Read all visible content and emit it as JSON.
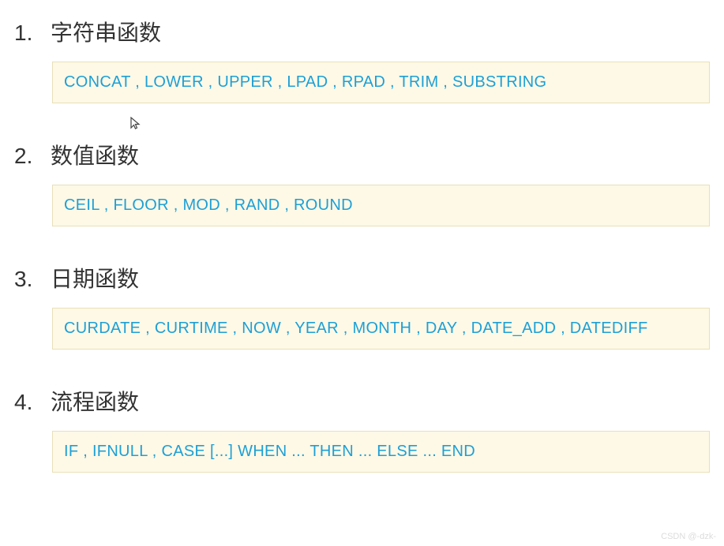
{
  "sections": [
    {
      "number": "1.",
      "title": "字符串函数",
      "content": "CONCAT , LOWER , UPPER , LPAD , RPAD , TRIM , SUBSTRING"
    },
    {
      "number": "2.",
      "title": "数值函数",
      "content": "CEIL , FLOOR , MOD , RAND , ROUND"
    },
    {
      "number": "3.",
      "title": "日期函数",
      "content": "CURDATE , CURTIME , NOW , YEAR , MONTH , DAY , DATE_ADD , DATEDIFF"
    },
    {
      "number": "4.",
      "title": "流程函数",
      "content": "IF  , IFNULL , CASE [...]  WHEN ...  THEN  ... ELSE ... END"
    }
  ],
  "watermark": "CSDN @-dzk-"
}
